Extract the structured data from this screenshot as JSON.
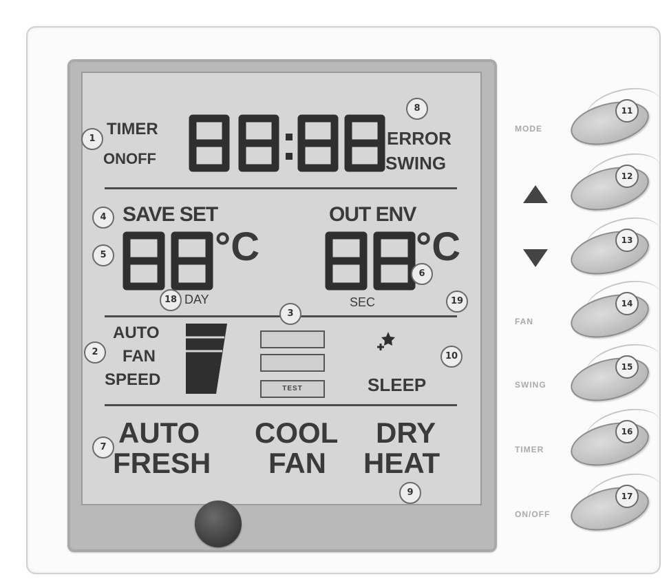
{
  "display": {
    "timer_label": "TIMER",
    "onoff_label": "ONOFF",
    "clock_digits": "88:88",
    "error_label": "ERROR",
    "swing_label": "SWING",
    "save_set_label": "SAVE SET",
    "out_env_label": "OUT ENV",
    "set_temp_digits": "88",
    "env_temp_digits": "88",
    "unit_celsius": "°C",
    "day_label": "DAY",
    "sec_label": "SEC",
    "fan_auto": "AUTO",
    "fan_fan": "FAN",
    "fan_speed": "SPEED",
    "sleep_label": "SLEEP",
    "mode_auto": "AUTO",
    "mode_fresh": "FRESH",
    "mode_cool": "COOL",
    "mode_fan": "FAN",
    "mode_dry": "DRY",
    "mode_heat": "HEAT",
    "test_label": "TEST"
  },
  "callouts": {
    "c1": "1",
    "c2": "2",
    "c3": "3",
    "c4": "4",
    "c5": "5",
    "c6": "6",
    "c7": "7",
    "c8": "8",
    "c9": "9",
    "c10": "10",
    "c18": "18",
    "c19": "19"
  },
  "buttons": [
    {
      "number": "11",
      "label": "MODE",
      "icon": ""
    },
    {
      "number": "12",
      "label": "",
      "icon": "up-triangle-icon"
    },
    {
      "number": "13",
      "label": "",
      "icon": "down-triangle-icon"
    },
    {
      "number": "14",
      "label": "FAN",
      "icon": ""
    },
    {
      "number": "15",
      "label": "SWING",
      "icon": ""
    },
    {
      "number": "16",
      "label": "TIMER",
      "icon": ""
    },
    {
      "number": "17",
      "label": "ON/OFF",
      "icon": ""
    }
  ],
  "colors": {
    "lcd_background": "#d6d6d6",
    "bezel": "#b9b9b9",
    "segment": "#2f2f2f",
    "button": "#c6c6c6"
  }
}
